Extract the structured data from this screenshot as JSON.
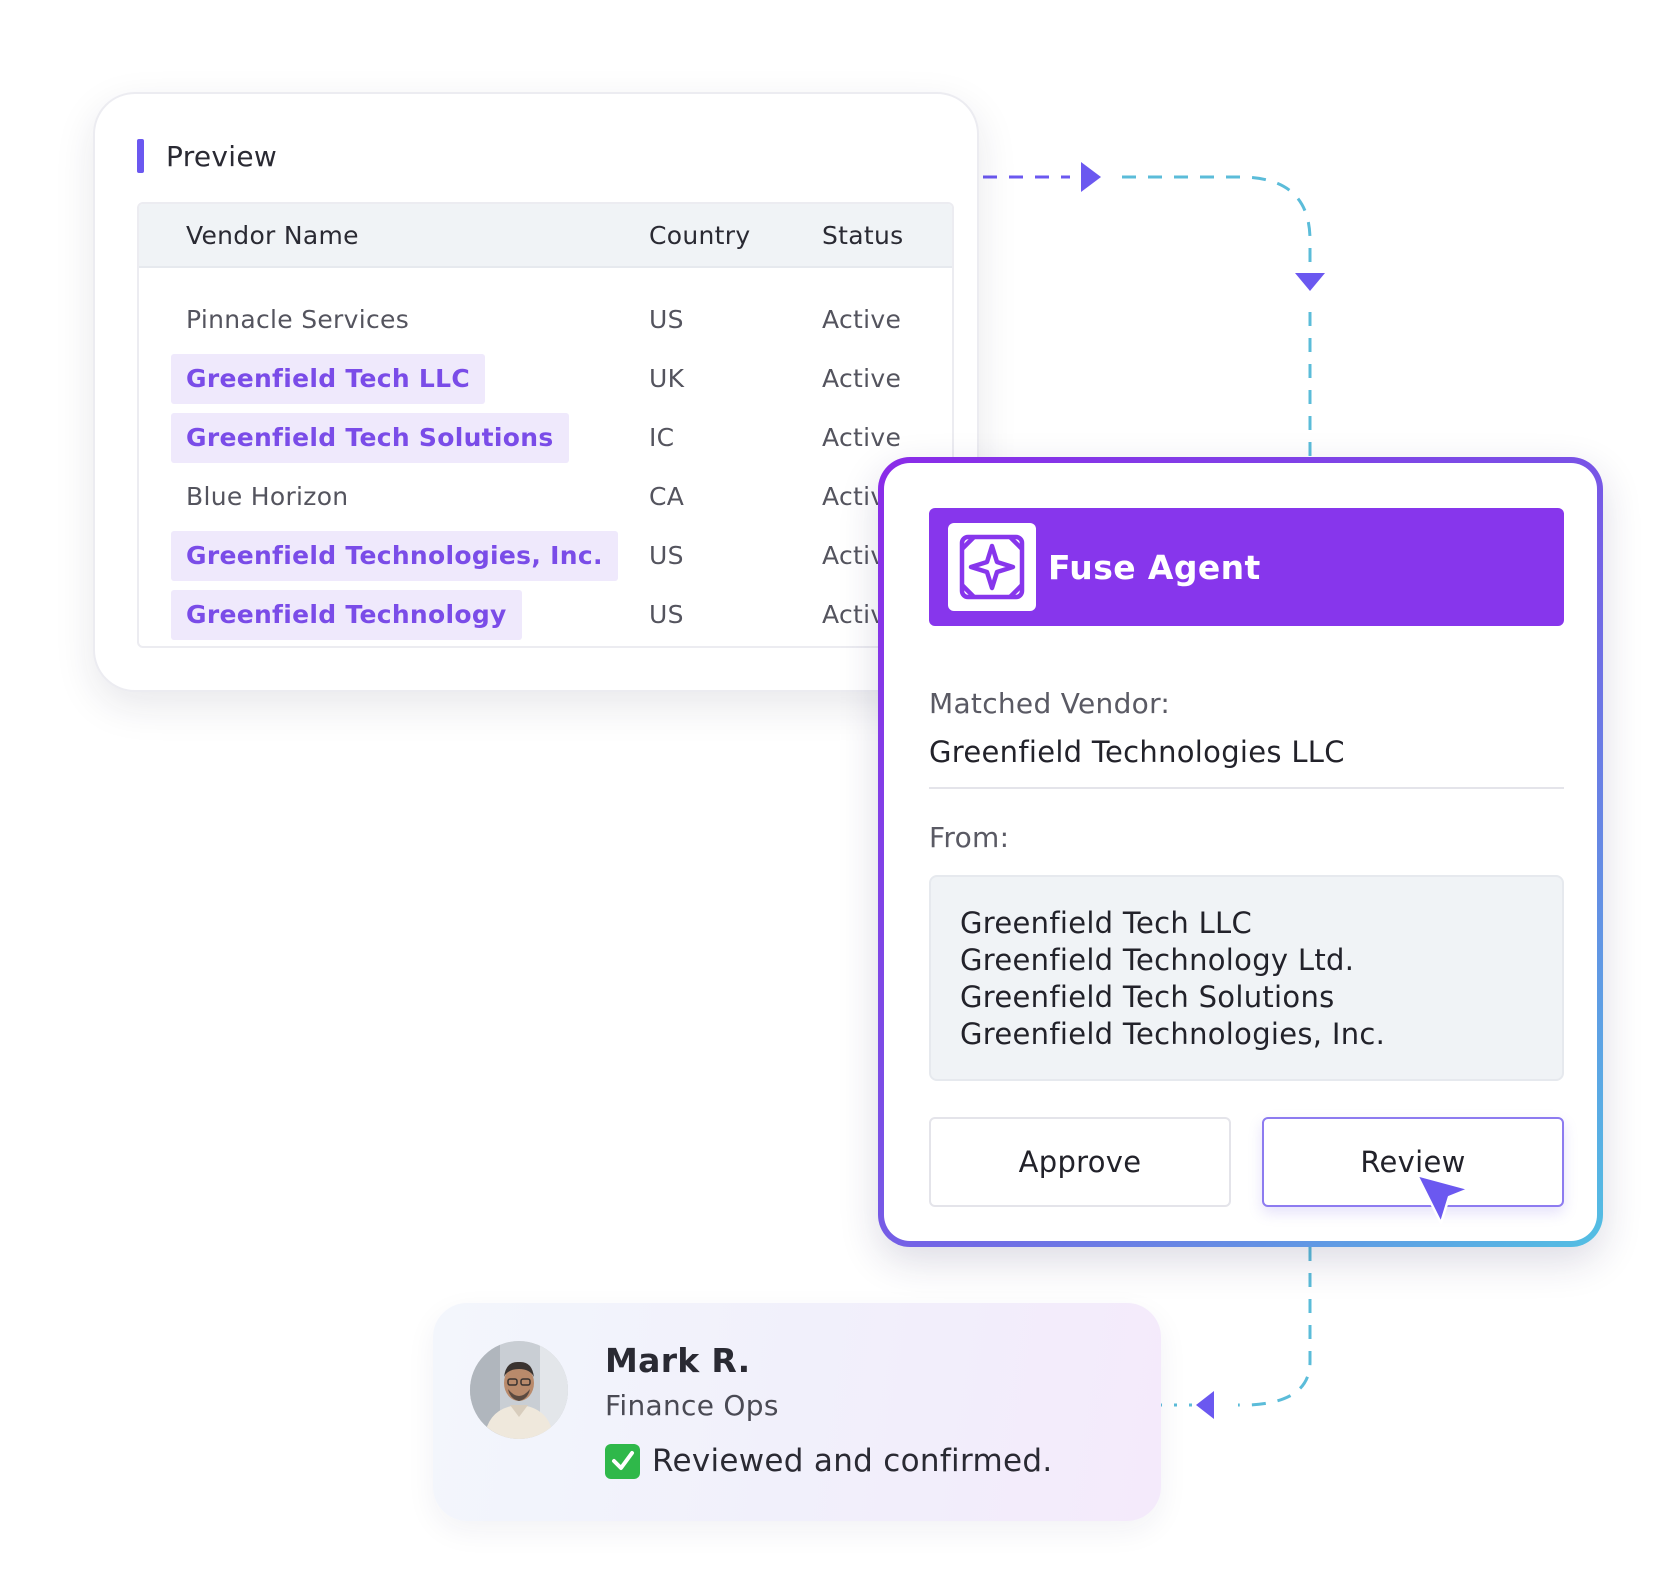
{
  "preview": {
    "title": "Preview",
    "columns": [
      "Vendor Name",
      "Country",
      "Status"
    ],
    "rows": [
      {
        "vendor": "Pinnacle Services",
        "country": "US",
        "status": "Active",
        "highlighted": false
      },
      {
        "vendor": "Greenfield Tech LLC",
        "country": "UK",
        "status": "Active",
        "highlighted": true
      },
      {
        "vendor": "Greenfield Tech Solutions",
        "country": "IC",
        "status": "Active",
        "highlighted": true
      },
      {
        "vendor": "Blue Horizon",
        "country": "CA",
        "status": "Active",
        "highlighted": false
      },
      {
        "vendor": "Greenfield Technologies, Inc.",
        "country": "US",
        "status": "Active",
        "highlighted": true
      },
      {
        "vendor": "Greenfield Technology",
        "country": "US",
        "status": "Active",
        "highlighted": true
      }
    ]
  },
  "agent": {
    "title": "Fuse Agent",
    "logo_icon": "sparkle-icon",
    "matched_label": "Matched Vendor:",
    "matched_value": "Greenfield Technologies LLC",
    "from_label": "From:",
    "from_items": [
      "Greenfield Tech LLC",
      "Greenfield Technology Ltd.",
      "Greenfield Tech Solutions",
      "Greenfield Technologies, Inc."
    ],
    "approve_label": "Approve",
    "review_label": "Review"
  },
  "reviewer": {
    "name": "Mark R.",
    "role": "Finance Ops",
    "status": "Reviewed and confirmed.",
    "status_icon": "check-icon"
  },
  "colors": {
    "accent_purple": "#8736ec",
    "highlight_text": "#7a4ce8",
    "highlight_bg": "#efe9fc",
    "connector": "#5bbcd9",
    "arrow": "#6b58f0",
    "check_green": "#2fb84a"
  }
}
